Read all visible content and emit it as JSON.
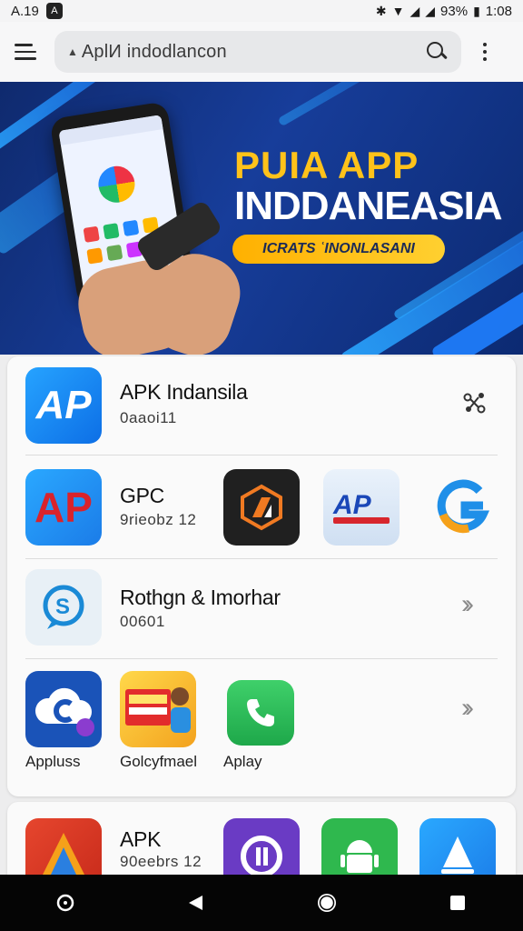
{
  "status_bar": {
    "time": "A.19",
    "app_badge": "A",
    "battery": "93%",
    "clock": "1:08"
  },
  "url_bar": {
    "url": "AplИ indodlancon"
  },
  "banner": {
    "title": "PUIA APP",
    "subtitle": "INDDANEASIA",
    "tag": "ICRATS ʿINONLASANI"
  },
  "apps": [
    {
      "title": "APK Indansila",
      "meta": "0aaoi11",
      "icon_label": "AP"
    },
    {
      "title": "GPC",
      "meta": "9rieobz   12",
      "icon_label": "AP"
    },
    {
      "title": "Rothgn & Imorhar",
      "meta": "00601",
      "icon_label": "S"
    }
  ],
  "icon_grid_captions": [
    "Appluss",
    "Golcyfmael",
    "Aplay"
  ],
  "bottom_card": {
    "title": "APK",
    "meta": "90eebrs  12"
  },
  "colors": {
    "accent_blue": "#1a86f0",
    "banner_yellow": "#ffc21a",
    "banner_bg": "#173d9a"
  }
}
